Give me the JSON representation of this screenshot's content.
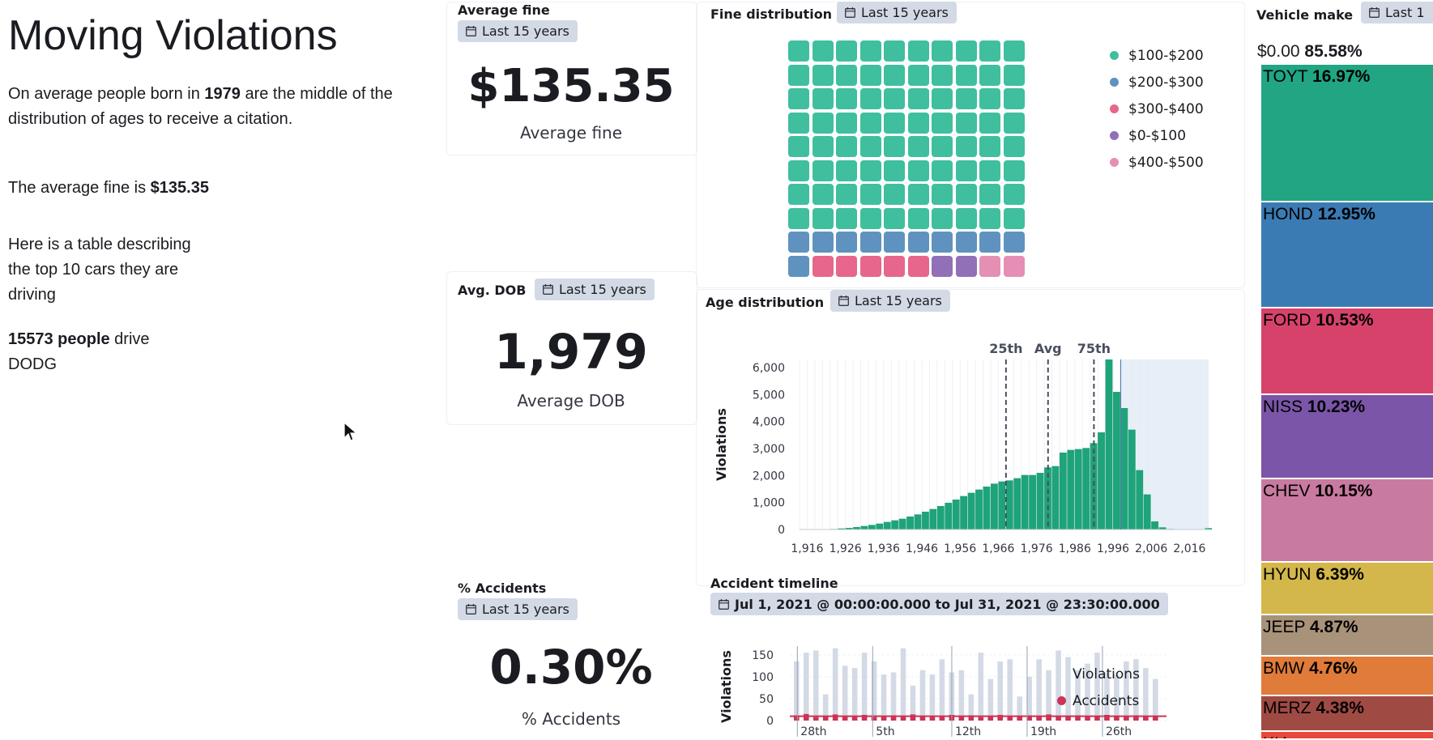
{
  "page_title": "Moving Violations",
  "markdown": {
    "p1_a": "On average people born in ",
    "p1_b": "1979",
    "p1_c": " are the middle of the",
    "p1_d": "distribution of ages to receive a citation.",
    "p2_a": "The average fine is ",
    "p2_b": "$135.35",
    "p3_l1": "Here is a table describing",
    "p3_l2": "the top 10 cars they are",
    "p3_l3": "driving",
    "p4_a": "15573 people",
    "p4_b": " drive",
    "p4_c": "DODG"
  },
  "time_badge": "Last 15 years",
  "avg_fine": {
    "title": "Average fine",
    "value": "$135.35",
    "label": "Average fine"
  },
  "avg_dob": {
    "title": "Avg. DOB",
    "value": "1,979",
    "label": "Average DOB"
  },
  "pct_accidents": {
    "title": "% Accidents",
    "value": "0.30%",
    "label": "% Accidents"
  },
  "fine_dist": {
    "title": "Fine distribution",
    "legend": [
      {
        "label": "$100-$200",
        "color": "#3fbf9e"
      },
      {
        "label": "$200-$300",
        "color": "#6092c0"
      },
      {
        "label": "$300-$400",
        "color": "#e7668b"
      },
      {
        "label": "$0-$100",
        "color": "#9170b8"
      },
      {
        "label": "$400-$500",
        "color": "#e58fb5"
      }
    ],
    "cells": [
      80,
      11,
      5,
      2,
      2
    ]
  },
  "age_dist": {
    "title": "Age distribution",
    "ylabel": "Violations",
    "markers": [
      {
        "label": "25th",
        "x": 1968
      },
      {
        "label": "Avg",
        "x": 1979
      },
      {
        "label": "75th",
        "x": 1991
      }
    ],
    "x_ticks": [
      "1,916",
      "1,926",
      "1,936",
      "1,946",
      "1,956",
      "1,966",
      "1,976",
      "1,986",
      "1,996",
      "2,006",
      "2,016"
    ],
    "y_ticks": [
      "0",
      "1,000",
      "2,000",
      "3,000",
      "4,000",
      "5,000",
      "6,000"
    ]
  },
  "accident_timeline": {
    "title": "Accident timeline",
    "range": "Jul 1, 2021 @ 00:00:00.000 to Jul 31, 2021 @ 23:30:00.000",
    "ylabel": "Violations",
    "y_ticks": [
      "0",
      "50",
      "100",
      "150"
    ],
    "x_ticks": [
      "28th",
      "5th",
      "12th",
      "19th",
      "26th"
    ],
    "legend": [
      {
        "label": "Violations",
        "color": "#d3dae6"
      },
      {
        "label": "Accidents",
        "color": "#cc3355"
      }
    ]
  },
  "vehicle_make": {
    "title": "Vehicle make",
    "badge": "Last 1",
    "top_label": "$0.00",
    "top_pct": "85.58%",
    "items": [
      {
        "make": "TOYT",
        "pct": "16.97%",
        "color": "#21a583"
      },
      {
        "make": "HOND",
        "pct": "12.95%",
        "color": "#3b7bb4"
      },
      {
        "make": "FORD",
        "pct": "10.53%",
        "color": "#d6426a"
      },
      {
        "make": "NISS",
        "pct": "10.23%",
        "color": "#7b55a8"
      },
      {
        "make": "CHEV",
        "pct": "10.15%",
        "color": "#c97aa0"
      },
      {
        "make": "HYUN",
        "pct": "6.39%",
        "color": "#d3b74a"
      },
      {
        "make": "JEEP",
        "pct": "4.87%",
        "color": "#a8937a"
      },
      {
        "make": "BMW",
        "pct": "4.76%",
        "color": "#e07b3a"
      },
      {
        "make": "MERZ",
        "pct": "4.38%",
        "color": "#a04a44"
      },
      {
        "make": "KIA",
        "pct": "",
        "color": "#e8483c"
      }
    ]
  },
  "chart_data": [
    {
      "type": "bar",
      "title": "Age distribution",
      "xlabel": "",
      "ylabel": "Violations",
      "ylim": [
        0,
        6300
      ],
      "xlim": [
        1914,
        2021
      ],
      "x": [
        1914,
        1916,
        1918,
        1920,
        1922,
        1924,
        1926,
        1928,
        1930,
        1932,
        1934,
        1936,
        1938,
        1940,
        1942,
        1944,
        1946,
        1948,
        1950,
        1952,
        1954,
        1956,
        1958,
        1960,
        1962,
        1964,
        1966,
        1968,
        1970,
        1972,
        1974,
        1976,
        1978,
        1980,
        1982,
        1984,
        1986,
        1988,
        1990,
        1992,
        1994,
        1996,
        1998,
        2000,
        2002,
        2004,
        2006,
        2008,
        2010,
        2012,
        2014,
        2016,
        2018,
        2020
      ],
      "values": [
        0,
        0,
        5,
        10,
        20,
        40,
        60,
        90,
        130,
        170,
        220,
        280,
        340,
        400,
        480,
        560,
        660,
        760,
        870,
        990,
        1110,
        1240,
        1360,
        1480,
        1590,
        1700,
        1780,
        1820,
        1900,
        2020,
        2020,
        2100,
        2300,
        2350,
        2850,
        2950,
        2980,
        3020,
        3200,
        3600,
        6400,
        5100,
        4500,
        3700,
        2200,
        1300,
        300,
        80,
        20,
        10,
        5,
        5,
        5,
        50
      ],
      "grid": true
    },
    {
      "type": "bar",
      "title": "Accident timeline",
      "ylabel": "Violations",
      "ylim": [
        0,
        170
      ],
      "categories": [
        "28th",
        "5th",
        "12th",
        "19th",
        "26th"
      ],
      "series": [
        {
          "name": "Violations",
          "values": [
            135,
            155,
            160,
            60,
            165,
            125,
            120,
            155,
            135,
            105,
            110,
            165,
            80,
            115,
            105,
            140,
            110,
            115,
            60,
            155,
            95,
            135,
            140,
            55,
            100,
            140,
            115,
            160,
            145,
            115,
            130,
            155,
            110,
            105,
            135,
            140,
            120,
            95
          ]
        },
        {
          "name": "Accidents",
          "values": [
            12,
            15,
            8,
            10,
            14,
            9,
            11,
            13,
            8,
            10,
            12,
            9,
            14,
            10,
            11,
            9,
            13,
            10,
            12,
            8,
            9,
            13,
            10,
            11,
            12,
            9,
            14,
            10,
            11,
            12,
            10,
            9,
            13,
            11,
            10,
            12,
            11,
            10
          ]
        }
      ]
    }
  ]
}
